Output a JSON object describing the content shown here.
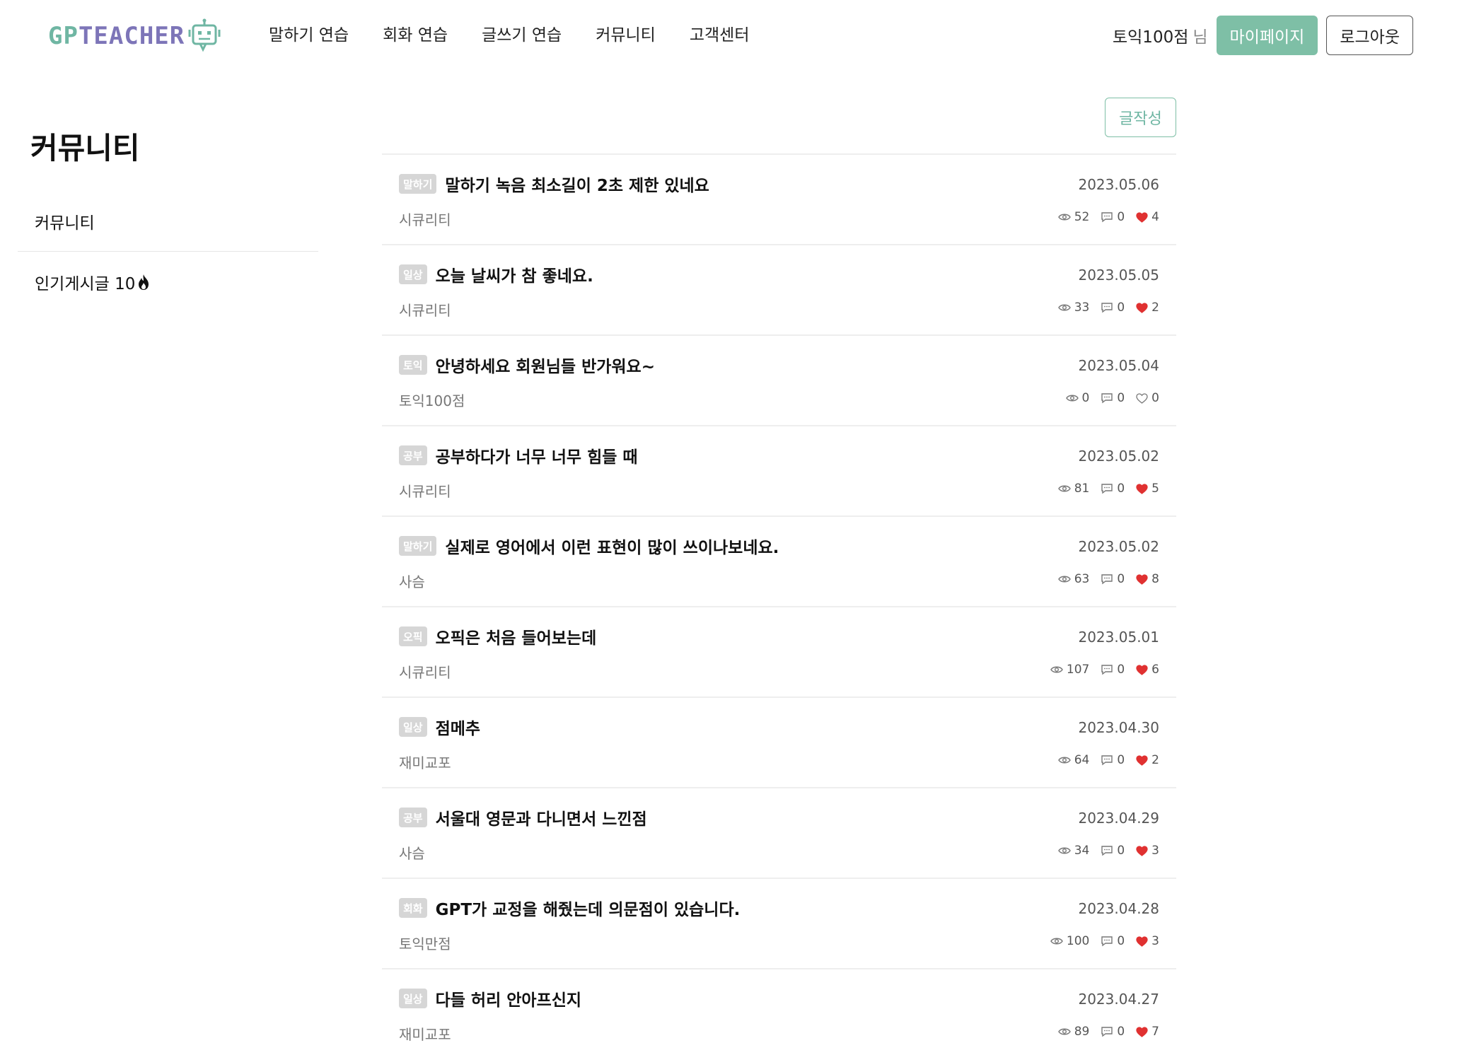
{
  "header": {
    "logo_text_a": "GP",
    "logo_text_b": "TEACHER",
    "nav": [
      "말하기 연습",
      "회화 연습",
      "글쓰기 연습",
      "커뮤니티",
      "고객센터"
    ],
    "user_name": "토익100점",
    "user_suffix": "님",
    "mypage_label": "마이페이지",
    "logout_label": "로그아웃"
  },
  "sidebar": {
    "title": "커뮤니티",
    "items": [
      {
        "label": "커뮤니티"
      },
      {
        "label": "인기게시글 10"
      }
    ]
  },
  "main": {
    "write_label": "글작성",
    "posts": [
      {
        "badge": "말하기",
        "title": "말하기 녹음 최소길이 2초 제한 있네요",
        "date": "2023.05.06",
        "author": "시큐리티",
        "views": "52",
        "comments": "0",
        "likes": "4",
        "liked": true
      },
      {
        "badge": "일상",
        "title": "오늘 날씨가 참 좋네요.",
        "date": "2023.05.05",
        "author": "시큐리티",
        "views": "33",
        "comments": "0",
        "likes": "2",
        "liked": true
      },
      {
        "badge": "토익",
        "title": "안녕하세요 회원님들 반가워요~",
        "date": "2023.05.04",
        "author": "토익100점",
        "views": "0",
        "comments": "0",
        "likes": "0",
        "liked": false
      },
      {
        "badge": "공부",
        "title": "공부하다가 너무 너무 힘들 때",
        "date": "2023.05.02",
        "author": "시큐리티",
        "views": "81",
        "comments": "0",
        "likes": "5",
        "liked": true
      },
      {
        "badge": "말하기",
        "title": "실제로 영어에서 이런 표현이 많이 쓰이나보네요.",
        "date": "2023.05.02",
        "author": "사슴",
        "views": "63",
        "comments": "0",
        "likes": "8",
        "liked": true
      },
      {
        "badge": "오픽",
        "title": "오픽은 처음 들어보는데",
        "date": "2023.05.01",
        "author": "시큐리티",
        "views": "107",
        "comments": "0",
        "likes": "6",
        "liked": true
      },
      {
        "badge": "일상",
        "title": "점메추",
        "date": "2023.04.30",
        "author": "재미교포",
        "views": "64",
        "comments": "0",
        "likes": "2",
        "liked": true
      },
      {
        "badge": "공부",
        "title": "서울대 영문과 다니면서 느낀점",
        "date": "2023.04.29",
        "author": "사슴",
        "views": "34",
        "comments": "0",
        "likes": "3",
        "liked": true
      },
      {
        "badge": "회화",
        "title": "GPT가 교정을 해줬는데 의문점이 있습니다.",
        "date": "2023.04.28",
        "author": "토익만점",
        "views": "100",
        "comments": "0",
        "likes": "3",
        "liked": true
      },
      {
        "badge": "일상",
        "title": "다들 허리 안아프신지",
        "date": "2023.04.27",
        "author": "재미교포",
        "views": "89",
        "comments": "0",
        "likes": "7",
        "liked": true
      }
    ]
  },
  "colors": {
    "brand_green": "#7ebfa6",
    "brand_purple": "#7d75b8",
    "like_red": "#e03131",
    "badge_gray": "#d6d6d6"
  },
  "icons": [
    "robot-logo-icon",
    "fire-icon",
    "eye-icon",
    "comment-icon",
    "heart-icon"
  ]
}
